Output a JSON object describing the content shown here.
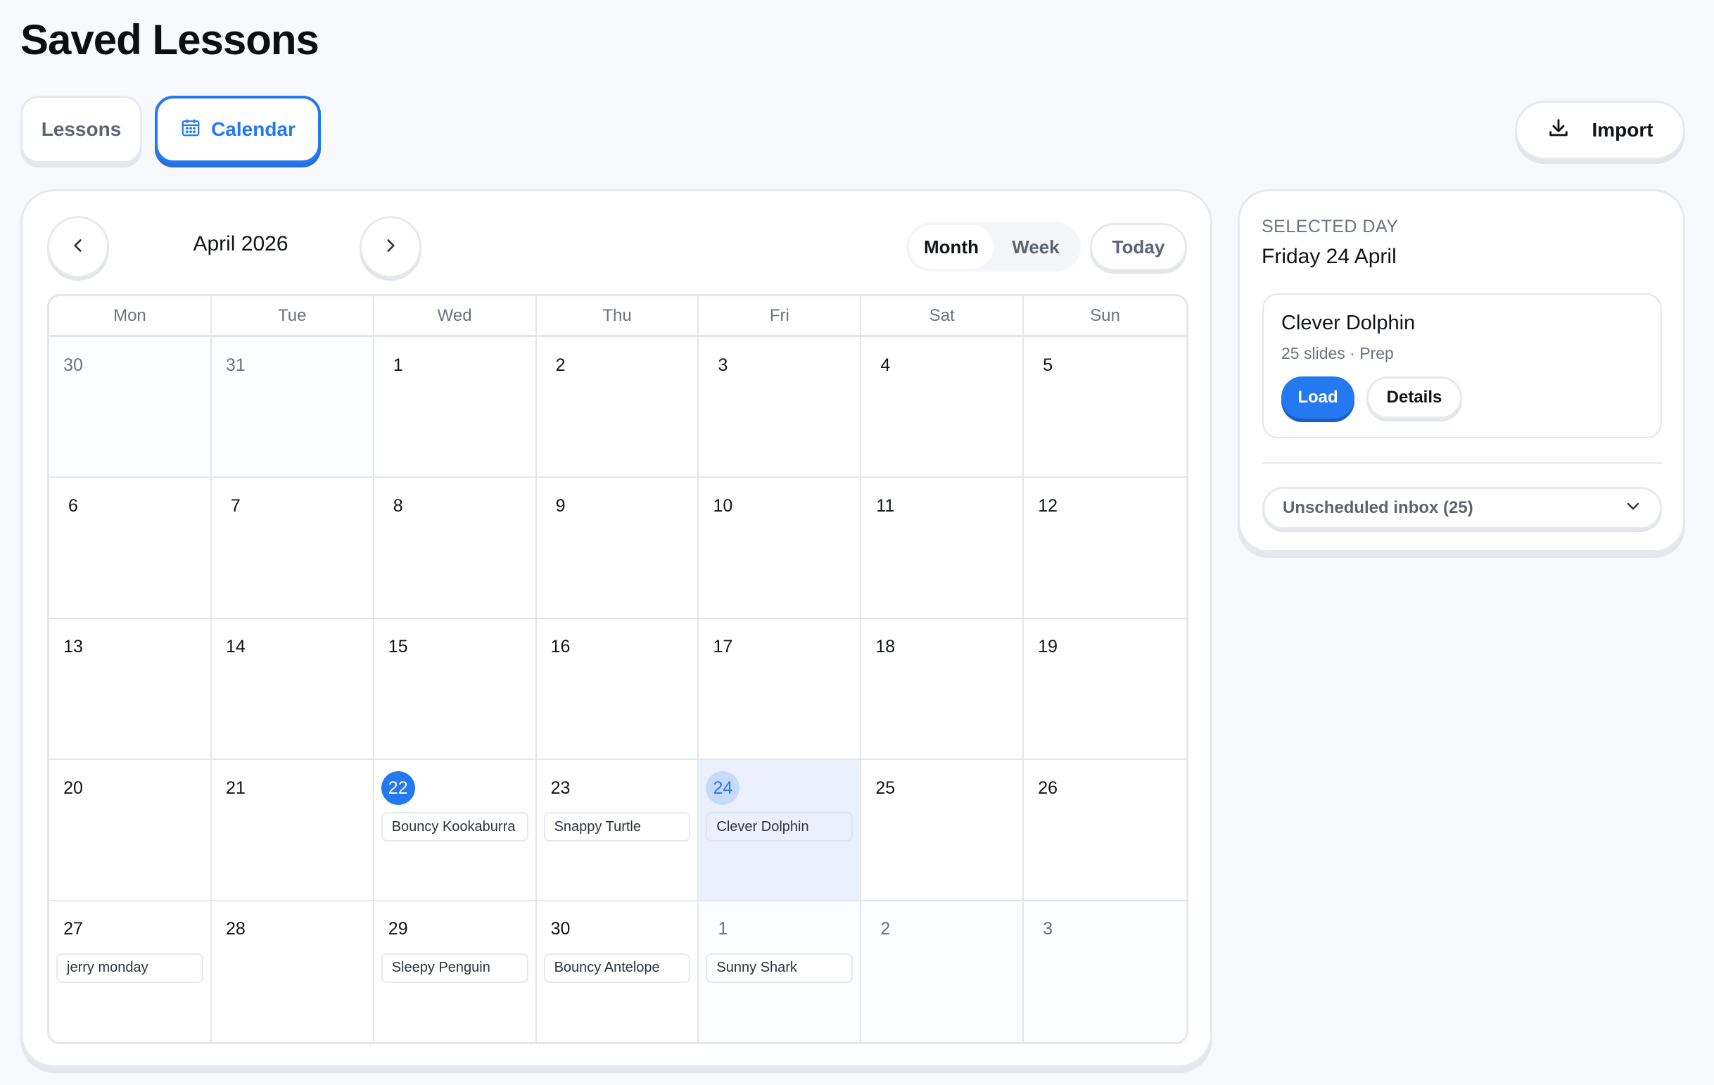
{
  "page": {
    "title": "Saved Lessons"
  },
  "tabs": {
    "lessons": "Lessons",
    "calendar": "Calendar"
  },
  "toolbar": {
    "import_label": "Import"
  },
  "calendar": {
    "month_label": "April 2026",
    "view_options": {
      "month": "Month",
      "week": "Week"
    },
    "today_label": "Today",
    "weekdays": [
      "Mon",
      "Tue",
      "Wed",
      "Thu",
      "Fri",
      "Sat",
      "Sun"
    ],
    "days": [
      {
        "n": "30",
        "outside": true
      },
      {
        "n": "31",
        "outside": true
      },
      {
        "n": "1"
      },
      {
        "n": "2"
      },
      {
        "n": "3"
      },
      {
        "n": "4"
      },
      {
        "n": "5"
      },
      {
        "n": "6"
      },
      {
        "n": "7"
      },
      {
        "n": "8"
      },
      {
        "n": "9"
      },
      {
        "n": "10"
      },
      {
        "n": "11"
      },
      {
        "n": "12"
      },
      {
        "n": "13"
      },
      {
        "n": "14"
      },
      {
        "n": "15"
      },
      {
        "n": "16"
      },
      {
        "n": "17"
      },
      {
        "n": "18"
      },
      {
        "n": "19"
      },
      {
        "n": "20"
      },
      {
        "n": "21"
      },
      {
        "n": "22",
        "today": true,
        "event": "Bouncy Kookaburra"
      },
      {
        "n": "23",
        "event": "Snappy Turtle"
      },
      {
        "n": "24",
        "selected": true,
        "event": "Clever Dolphin"
      },
      {
        "n": "25"
      },
      {
        "n": "26"
      },
      {
        "n": "27",
        "event": "jerry monday"
      },
      {
        "n": "28"
      },
      {
        "n": "29",
        "event": "Sleepy Penguin"
      },
      {
        "n": "30",
        "event": "Bouncy Antelope"
      },
      {
        "n": "1",
        "outside": true,
        "event": "Sunny Shark"
      },
      {
        "n": "2",
        "outside": true
      },
      {
        "n": "3",
        "outside": true
      }
    ]
  },
  "sidebar": {
    "caption": "SELECTED DAY",
    "date": "Friday 24 April",
    "lesson": {
      "title": "Clever Dolphin",
      "meta": "25 slides · Prep",
      "load_label": "Load",
      "details_label": "Details"
    },
    "inbox_label": "Unscheduled inbox (25)"
  },
  "colors": {
    "accent": "#2478f0",
    "selected_bg": "#eaf1fd",
    "page_bg": "#f7f9fc"
  },
  "icons": {
    "calendar_tab": "calendar-icon",
    "import": "download-icon",
    "prev": "chevron-left-icon",
    "next": "chevron-right-icon",
    "inbox": "chevron-down-icon"
  }
}
